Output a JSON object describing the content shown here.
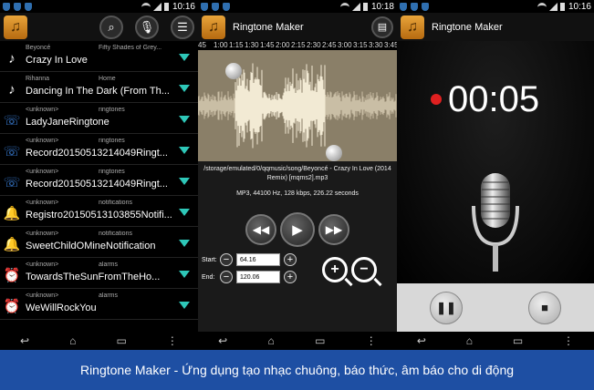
{
  "status": {
    "time1": "10:16",
    "time2": "10:18",
    "time3": "10:16"
  },
  "panel1": {
    "rows": [
      {
        "artist": "Beyoncé",
        "album": "Fifty Shades of Grey...",
        "title": "Crazy In Love",
        "icon": "♪"
      },
      {
        "artist": "Rihanna",
        "album": "Home",
        "title": "Dancing In The Dark (From Th...",
        "icon": "♪"
      },
      {
        "artist": "<unknown>",
        "album": "ringtones",
        "title": "LadyJaneRingtone",
        "icon": "☏"
      },
      {
        "artist": "<unknown>",
        "album": "ringtones",
        "title": "Record20150513214049Ringt...",
        "icon": "☏"
      },
      {
        "artist": "<unknown>",
        "album": "ringtones",
        "title": "Record20150513214049Ringt...",
        "icon": "☏"
      },
      {
        "artist": "<unknown>",
        "album": "notifications",
        "title": "Registro20150513103855Notifi...",
        "icon": "🔔"
      },
      {
        "artist": "<unknown>",
        "album": "notifications",
        "title": "SweetChildOMineNotification",
        "icon": "🔔"
      },
      {
        "artist": "<unknown>",
        "album": "alarms",
        "title": "TowardsTheSunFromTheHo...",
        "icon": "⏰"
      },
      {
        "artist": "<unknown>",
        "album": "alarms",
        "title": "WeWillRockYou",
        "icon": "⏰"
      }
    ]
  },
  "panel2": {
    "title": "Ringtone Maker",
    "ruler": [
      "45",
      "1:00",
      "1:15",
      "1:30",
      "1:45",
      "2:00",
      "2:15",
      "2:30",
      "2:45",
      "3:00",
      "3:15",
      "3:30",
      "3:45"
    ],
    "path": "/storage/emulated/0/qqmusic/song/Beyoncé - Crazy In Love (2014 Remix) [mqms2].mp3",
    "info": "MP3, 44100 Hz, 128 kbps, 226.22 seconds",
    "start_label": "Start:",
    "start_value": "64.16",
    "end_label": "End:",
    "end_value": "120.06"
  },
  "panel3": {
    "title": "Ringtone Maker",
    "timer": "00:05"
  },
  "banner": "Ringtone Maker - Ứng dụng tạo nhạc chuông, báo thức, âm báo cho di động",
  "colors": {
    "accent": "#2ec7b8",
    "banner": "#1e4fa3",
    "record": "#e02020"
  }
}
